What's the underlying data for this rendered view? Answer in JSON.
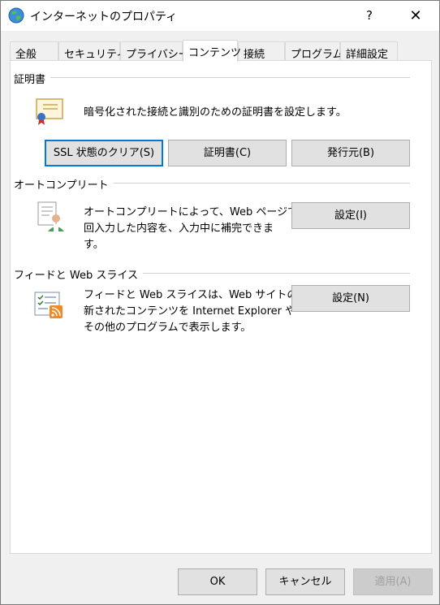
{
  "window": {
    "title": "インターネットのプロパティ",
    "help_label": "?",
    "close_label": "✕"
  },
  "tabs": [
    {
      "label": "全般"
    },
    {
      "label": "セキュリティ"
    },
    {
      "label": "プライバシー"
    },
    {
      "label": "コンテンツ"
    },
    {
      "label": "接続"
    },
    {
      "label": "プログラム"
    },
    {
      "label": "詳細設定"
    }
  ],
  "certificates": {
    "group_label": "証明書",
    "description": "暗号化された接続と識別のための証明書を設定します。",
    "ssl_button": "SSL 状態のクリア(S)",
    "cert_button": "証明書(C)",
    "publisher_button": "発行元(B)"
  },
  "autocomplete": {
    "group_label": "オートコンプリート",
    "description_line1": "オートコンプリートによって、Web ページで前",
    "description_line2": "回入力した内容を、入力中に補完できま",
    "description_line3": "す。",
    "settings_button": "設定(I)"
  },
  "feeds": {
    "group_label": "フィードと Web スライス",
    "description_line1": "フィードと Web スライスは、Web サイトの更",
    "description_line2": "新されたコンテンツを Internet Explorer や",
    "description_line3": "その他のプログラムで表示します。",
    "settings_button": "設定(N)"
  },
  "footer": {
    "ok_label": "OK",
    "cancel_label": "キャンセル",
    "apply_label": "適用(A)"
  },
  "colors": {
    "focus_border": "#0078d7",
    "button_face": "#e1e1e1",
    "dialog_bg": "#f0f0f0"
  },
  "icons": {
    "title": "internet-globe-icon",
    "certificates": "certificate-icon",
    "autocomplete": "autocomplete-user-form-icon",
    "feeds": "rss-feed-list-icon"
  }
}
